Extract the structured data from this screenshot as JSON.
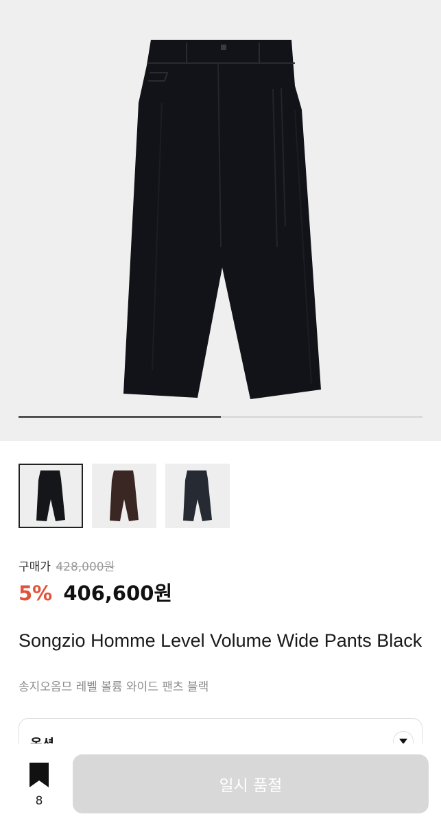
{
  "gallery": {
    "slide_progress": 0.5,
    "thumbnails": [
      {
        "name": "black",
        "color": "#15161a",
        "active": true
      },
      {
        "name": "brown",
        "color": "#3a2622",
        "active": false
      },
      {
        "name": "navy",
        "color": "#262a33",
        "active": false
      }
    ]
  },
  "price": {
    "label": "구매가",
    "original": "428,000원",
    "discount": "5%",
    "sale": "406,600원"
  },
  "product": {
    "title": "Songzio Homme Level Volume Wide Pants Black",
    "subtitle": "송지오옴므 레벨 볼륨 와이드 팬츠 블랙"
  },
  "options": {
    "label": "옵션"
  },
  "bottom_bar": {
    "bookmark_count": "8",
    "cta_label": "일시 품절"
  },
  "colors": {
    "discount": "#e0533a",
    "cta_disabled": "#d8d8d8",
    "hero_bg": "#efefef"
  }
}
